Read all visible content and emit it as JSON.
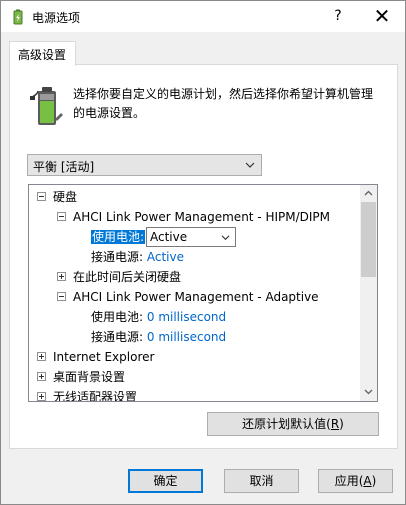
{
  "window": {
    "title": "电源选项",
    "help_glyph": "?",
    "close_glyph": "✕"
  },
  "tab": {
    "label": "高级设置"
  },
  "description": "选择你要自定义的电源计划，然后选择你希望计算机管理的电源设置。",
  "plan_select": {
    "value": "平衡 [活动]"
  },
  "tree": {
    "hard_disk": "硬盘",
    "ahci_hipm": "AHCI Link Power Management - HIPM/DIPM",
    "on_battery_label": "使用电池:",
    "on_battery_value": "Active",
    "plugged_in_label": "接通电源:",
    "plugged_in_value": "Active",
    "turn_off_disk": "在此时间后关闭硬盘",
    "ahci_adaptive": "AHCI Link Power Management - Adaptive",
    "adaptive_battery_label": "使用电池:",
    "adaptive_battery_value": "0 millisecond",
    "adaptive_plugged_label": "接通电源:",
    "adaptive_plugged_value": "0 millisecond",
    "internet_explorer": "Internet Explorer",
    "desktop_background": "桌面背景设置",
    "wireless_adapter": "无线适配器设置"
  },
  "buttons": {
    "restore_main": "还原计划默认值(",
    "restore_key": "R",
    "restore_end": ")",
    "ok": "确定",
    "cancel": "取消",
    "apply_main": "应用(",
    "apply_key": "A",
    "apply_end": ")"
  },
  "colors": {
    "accent": "#0078d7",
    "value_blue": "#0066cc"
  },
  "icons": {
    "app": "power-battery-icon",
    "header": "battery-plug-icon",
    "dropdown": "chevron-down-icon"
  }
}
